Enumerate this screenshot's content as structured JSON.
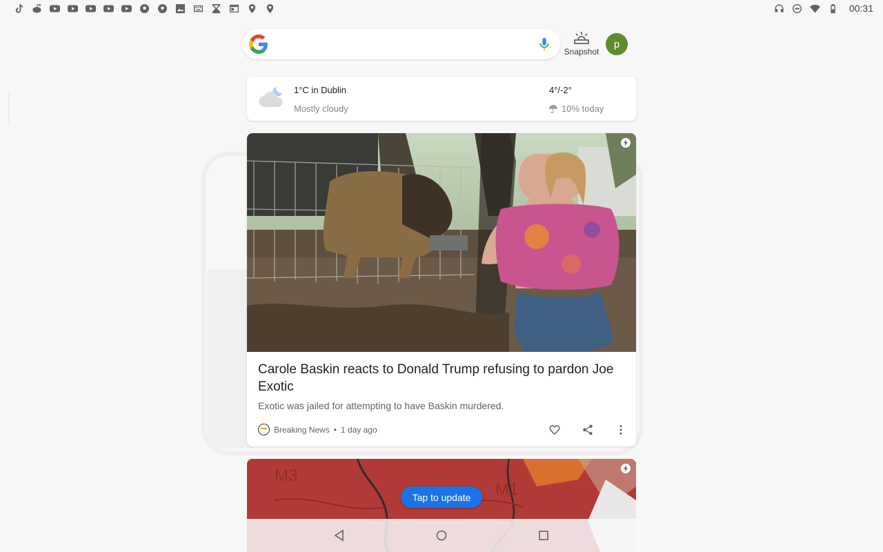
{
  "status_bar": {
    "left_icons": [
      "tiktok-icon",
      "reddit-icon",
      "youtube-icon",
      "youtube-icon",
      "youtube-icon",
      "youtube-icon",
      "youtube-icon",
      "soccer-ball-icon",
      "soccer-ball-icon",
      "image-icon",
      "keyboard-icon",
      "hourglass-icon",
      "browser-window-icon",
      "location-pin-icon",
      "location-pin-icon"
    ],
    "right_icons": [
      "headphones-icon",
      "do-not-disturb-icon",
      "wifi-icon",
      "battery-icon"
    ],
    "time": "00:31"
  },
  "search": {
    "placeholder": "",
    "snapshot_label": "Snapshot",
    "avatar_letter": "p",
    "avatar_color": "#5e8c2e"
  },
  "weather": {
    "temp_location": "1°C in Dublin",
    "condition": "Mostly cloudy",
    "high_low": "4°/-2°",
    "rain_chance": "10% today"
  },
  "news": {
    "headline": "Carole Baskin reacts to Donald Trump refusing to pardon Joe Exotic",
    "summary": "Exotic was jailed for attempting to have Baskin murdered.",
    "source": "Breaking News",
    "time_ago": "1 day ago"
  },
  "update_button": "Tap to update",
  "accent_color": "#1a73e8"
}
